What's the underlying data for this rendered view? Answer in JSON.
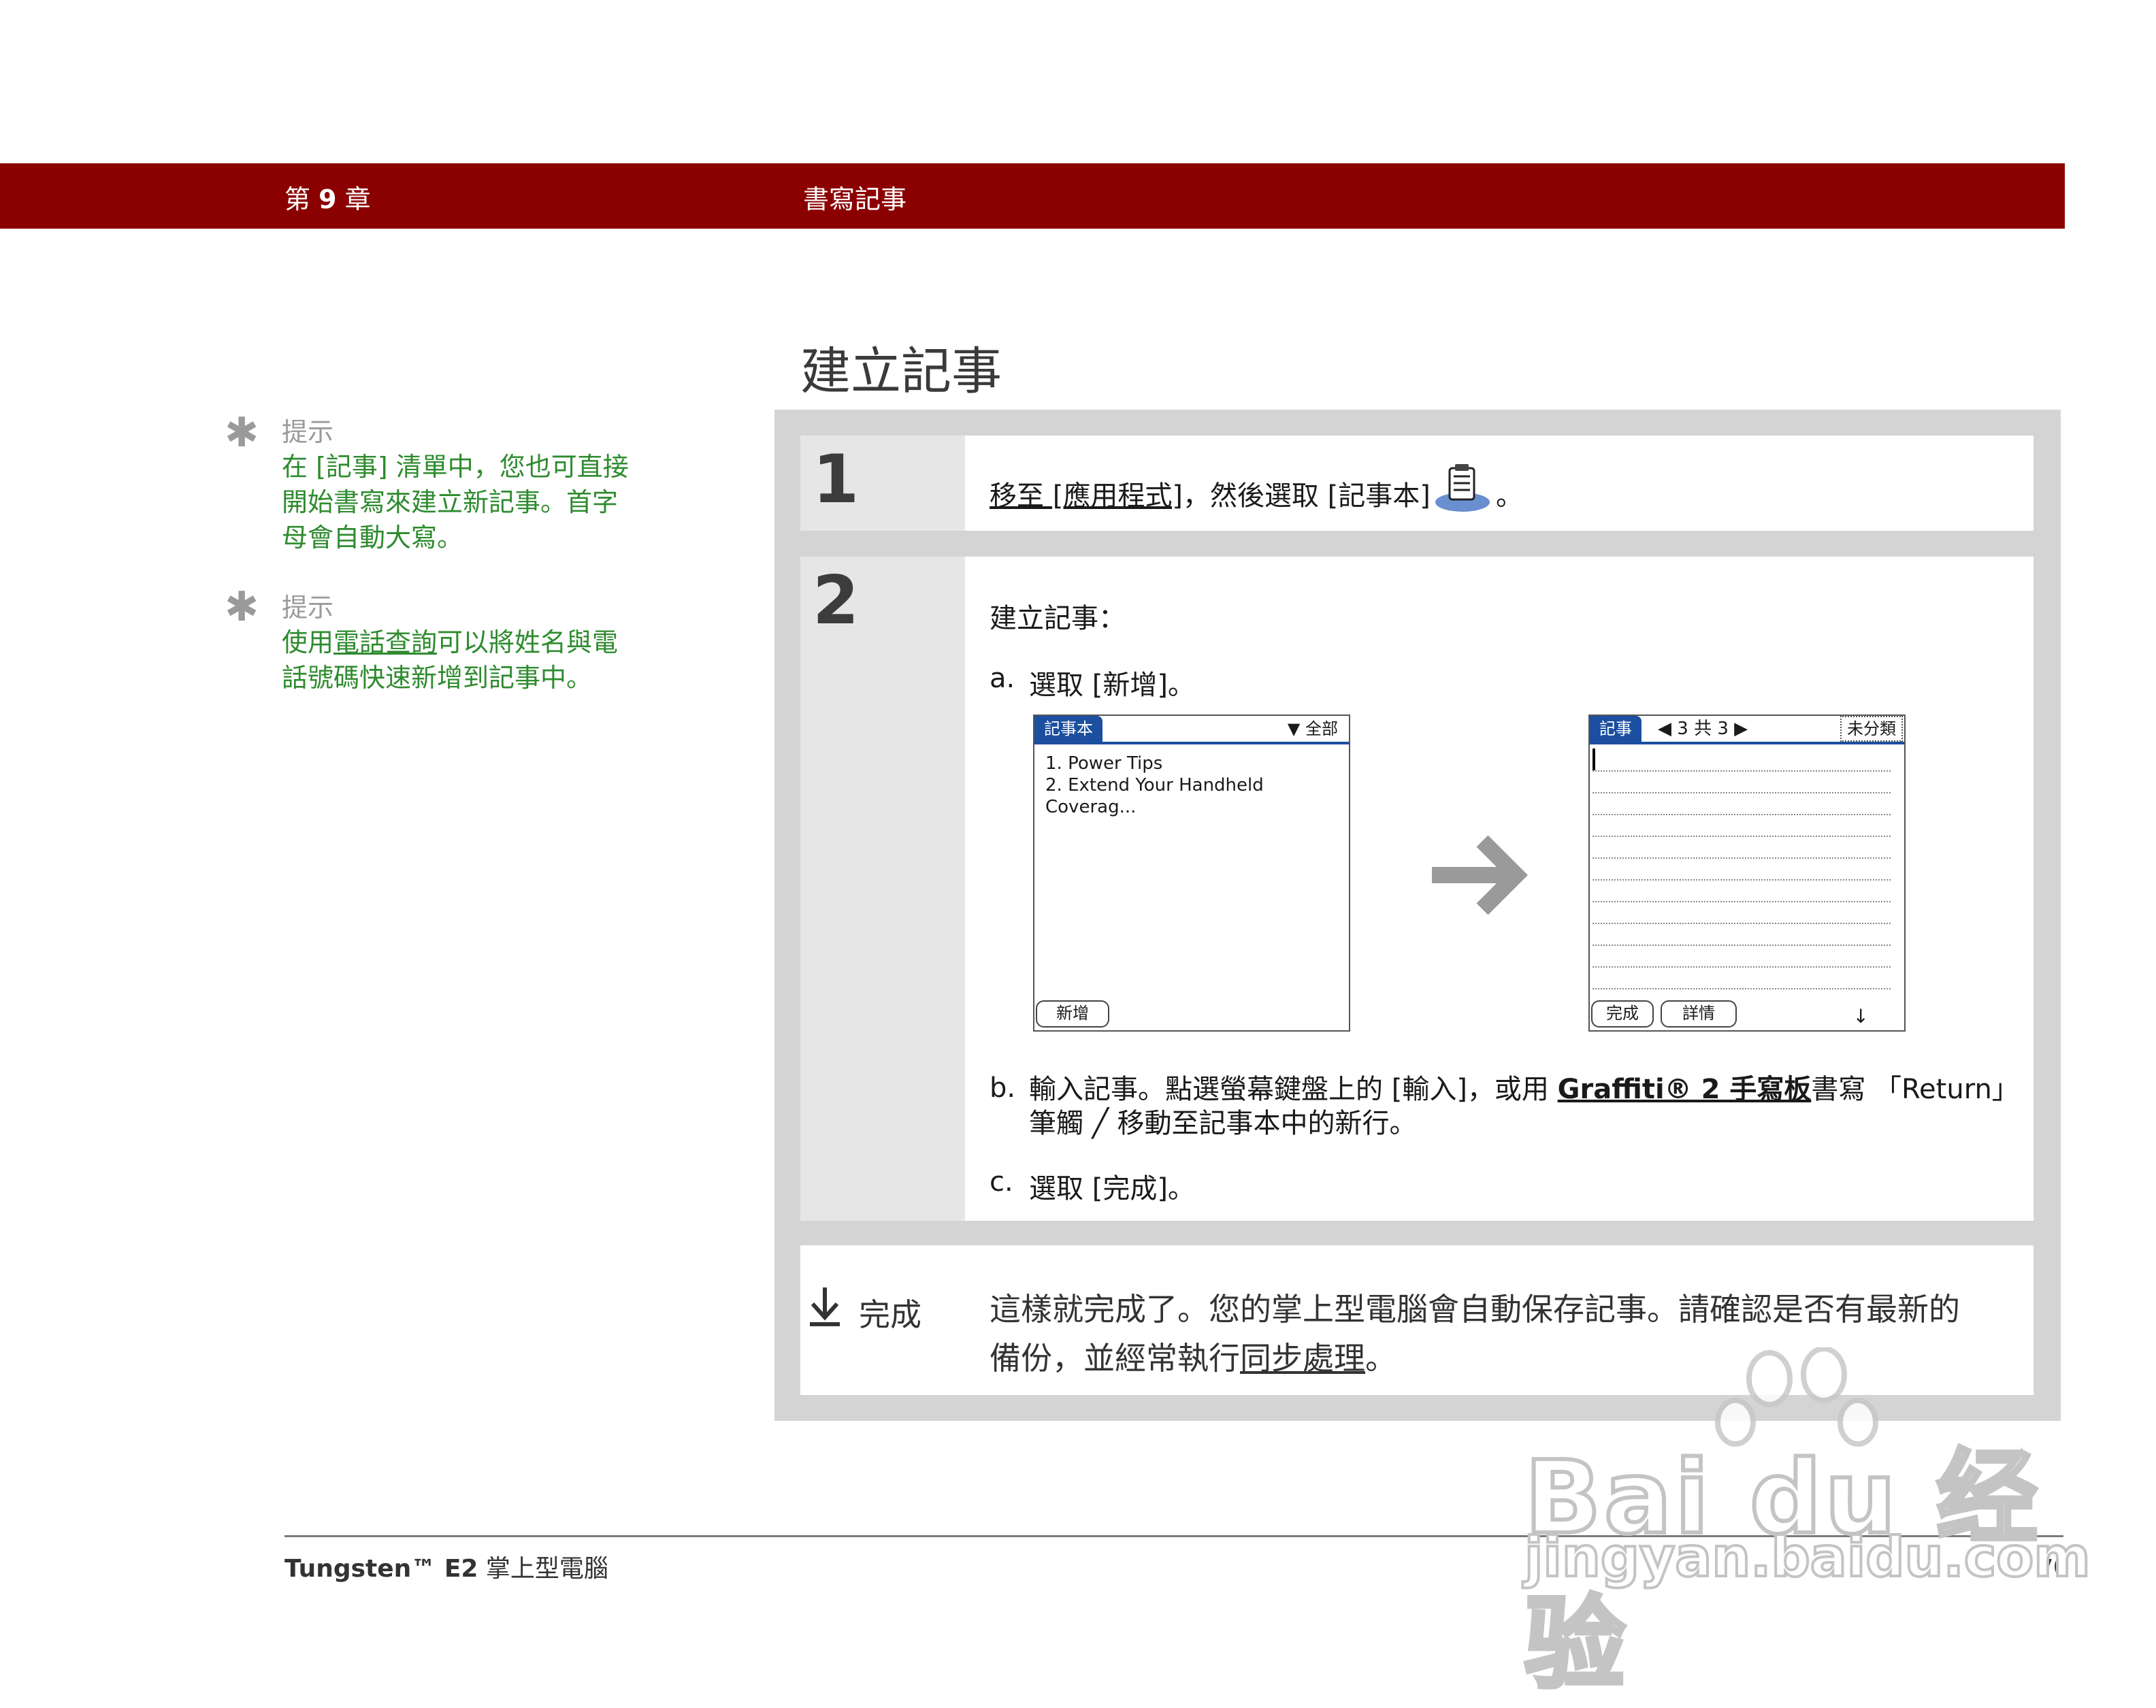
{
  "header": {
    "chapter_prefix": "第",
    "chapter_num": "9",
    "chapter_suffix": "章",
    "section": "書寫記事"
  },
  "page_title": "建立記事",
  "tips": [
    {
      "label": "提示",
      "body": "在 [記事] 清單中，您也可直接開始書寫來建立新記事。首字母會自動大寫。"
    },
    {
      "label": "提示",
      "body_before": "使用",
      "link": "電話查詢",
      "body_after": "可以將姓名與電話號碼快速新增到記事中。"
    }
  ],
  "step1": {
    "number": "1",
    "link": "移至 [應用程式]",
    "text_after": "，然後選取 [記事本]",
    "end": "。",
    "icon": "memo-pad-icon"
  },
  "step2": {
    "number": "2",
    "intro": "建立記事：",
    "a_label": "a.",
    "a_text": "選取 [新增]。",
    "b_label": "b.",
    "b_text_1": "輸入記事。點選螢幕鍵盤上的 [輸入]，或用",
    "b_link": "Graffiti® 2 手寫板",
    "b_text_2": "書寫 「Return」",
    "b_text_3": "筆觸",
    "b_text_4": "移動至記事本中的新行。",
    "c_label": "c.",
    "c_text": "選取 [完成]。"
  },
  "screen_list": {
    "tab": "記事本",
    "category": "全部",
    "items": [
      "1. Power Tips",
      "2. Extend Your Handheld Coverag..."
    ],
    "new_button": "新增"
  },
  "screen_edit": {
    "tab": "記事",
    "counter": "3 共 3",
    "category": "未分類",
    "done_button": "完成",
    "details_button": "詳情"
  },
  "done": {
    "label": "完成",
    "text_1": "這樣就完成了。您的掌上型電腦會自動保存記事。請確認是否有最新的",
    "text_2": "備份，並經常執行",
    "link": "同步處理",
    "end": "。"
  },
  "footer": {
    "product_bold": "Tungsten™ E2",
    "product_rest": " 掌上型電腦",
    "page": "70"
  },
  "watermark": {
    "logo": "Bai du 经验",
    "url": "jingyan.baidu.com"
  }
}
